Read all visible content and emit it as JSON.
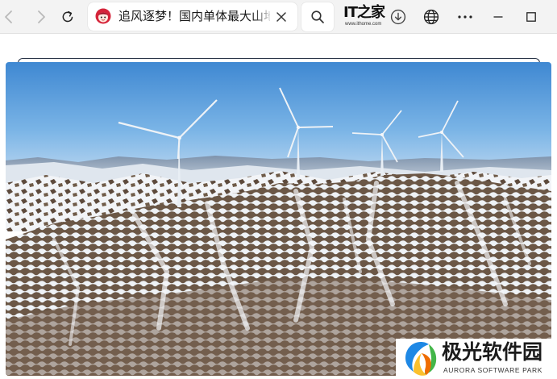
{
  "browser": {
    "tab": {
      "title": "追风逐梦！国内单体最大山地"
    },
    "brand_logo": {
      "main": "IT之家",
      "sub": "www.ithome.com"
    }
  },
  "page": {
    "photo": {
      "icon": "wind-turbine-photo"
    }
  },
  "watermark": {
    "title": "极光软件园",
    "subtitle": "AURORA SOFTWARE PARK"
  },
  "colors": {
    "toolbar_bg": "#f3f3f3",
    "sky": "#4f97d8",
    "accent": "#2a3548"
  }
}
